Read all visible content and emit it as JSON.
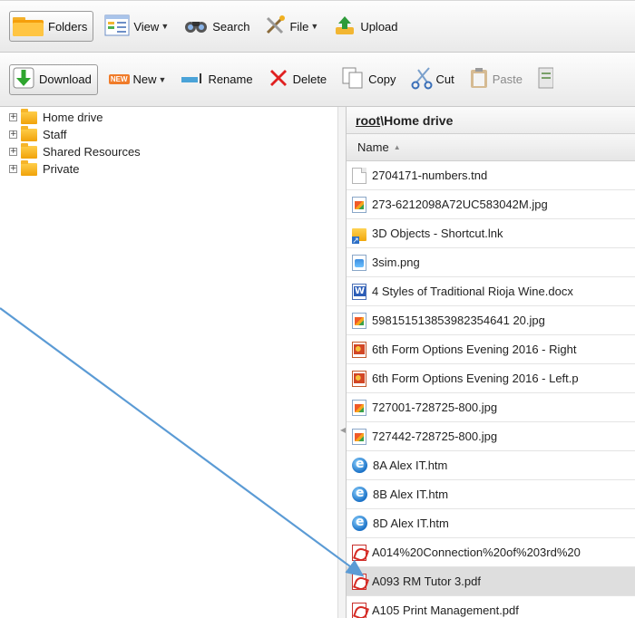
{
  "toolbar_top": {
    "folders_label": "Folders",
    "view_label": "View",
    "search_label": "Search",
    "file_label": "File",
    "upload_label": "Upload"
  },
  "toolbar_actions": {
    "download_label": "Download",
    "new_badge": "NEW",
    "new_label": "New",
    "rename_label": "Rename",
    "delete_label": "Delete",
    "copy_label": "Copy",
    "cut_label": "Cut",
    "paste_label": "Paste"
  },
  "tree": {
    "expander_glyph": "+",
    "items": [
      {
        "label": "Home drive"
      },
      {
        "label": "Staff"
      },
      {
        "label": "Shared Resources"
      },
      {
        "label": "Private"
      }
    ]
  },
  "path": {
    "root": "root",
    "separator": "\\",
    "current": "Home drive"
  },
  "columns": {
    "name_header": "Name",
    "sort_indicator": "▲"
  },
  "files": [
    {
      "name": "2704171-numbers.tnd",
      "icon": "blank-file-icon",
      "selected": false
    },
    {
      "name": "273-6212098A72UC583042M.jpg",
      "icon": "jpg-file-icon",
      "selected": false
    },
    {
      "name": "3D Objects - Shortcut.lnk",
      "icon": "shortcut-icon",
      "selected": false
    },
    {
      "name": "3sim.png",
      "icon": "png-file-icon",
      "selected": false
    },
    {
      "name": "4 Styles of Traditional Rioja Wine.docx",
      "icon": "word-doc-icon",
      "selected": false
    },
    {
      "name": "598151513853982354641 20.jpg",
      "icon": "jpg-file-icon",
      "selected": false
    },
    {
      "name": "6th Form Options Evening 2016 - Right",
      "icon": "powerpoint-icon",
      "selected": false
    },
    {
      "name": "6th Form Options Evening 2016 - Left.p",
      "icon": "powerpoint-icon",
      "selected": false
    },
    {
      "name": "727001-728725-800.jpg",
      "icon": "jpg-file-icon",
      "selected": false
    },
    {
      "name": "727442-728725-800.jpg",
      "icon": "jpg-file-icon",
      "selected": false
    },
    {
      "name": "8A Alex IT.htm",
      "icon": "ie-html-icon",
      "selected": false
    },
    {
      "name": "8B Alex IT.htm",
      "icon": "ie-html-icon",
      "selected": false
    },
    {
      "name": "8D Alex IT.htm",
      "icon": "ie-html-icon",
      "selected": false
    },
    {
      "name": "A014%20Connection%20of%203rd%20",
      "icon": "pdf-icon",
      "selected": false
    },
    {
      "name": "A093 RM Tutor 3.pdf",
      "icon": "pdf-icon",
      "selected": true
    },
    {
      "name": "A105 Print Management.pdf",
      "icon": "pdf-icon",
      "selected": false
    }
  ],
  "colors": {
    "selected_row": "#dedede",
    "annotation_arrow": "#5b9bd5",
    "delete_red": "#e02020",
    "download_green": "#2ea52e"
  }
}
